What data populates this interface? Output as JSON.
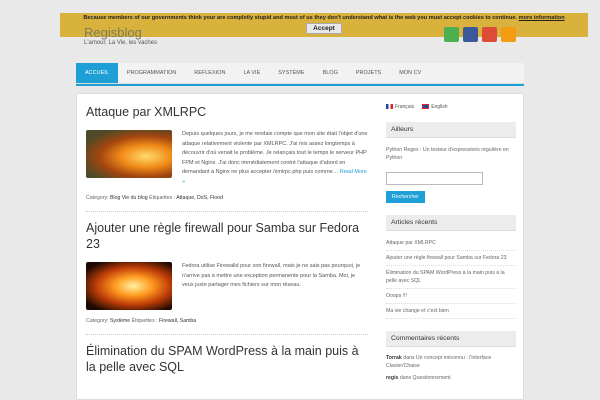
{
  "site": {
    "title": "Regisblog",
    "description": "L'amour, La Vie, les vaches"
  },
  "cookie": {
    "message": "Because members of our governments think your are completly stupid and most of us they don't understand what is the web you must accept cookies to continue.",
    "more_label": "more information",
    "accept_label": "Accept"
  },
  "social": [
    {
      "name": "twitter-icon",
      "color": "#4caf50"
    },
    {
      "name": "facebook-icon",
      "color": "#3b5998"
    },
    {
      "name": "google-plus-icon",
      "color": "#dd4b39"
    },
    {
      "name": "rss-icon",
      "color": "#f39c12"
    }
  ],
  "nav": {
    "items": [
      "ACCUEIL",
      "PROGRAMMATION",
      "REFLEXION",
      "LA VIE",
      "SYSTÈME",
      "BLOG",
      "PROJETS",
      "MON CV"
    ]
  },
  "posts": [
    {
      "title": "Attaque par XMLRPC",
      "excerpt": "Depuis quelques jours, je me rendais compte que mon site était l'objet d'une attaque relativement violente par XMLRPC. J'ai mis assez longtemps à découvrir d'où venait le problème. Je relançais tout le temps le serveur PHP FPM et Nginx. J'ai donc immédiatement contré l'attaque d'abord en demandant à Nginx ne plus accepter /xmlrpc.php puis comme…",
      "more": "Read More »",
      "category_label": "Category:",
      "categories": "Blog  Vie du blog",
      "tags_label": "Étiquettes :",
      "tags": "Attaque,  DoS,  Flood"
    },
    {
      "title": "Ajouter une règle firewall pour Samba sur Fedora 23",
      "excerpt": "Fedora utilise Firewalld pour son firewall, mais je ne sais pas pourquoi, je n'arrive pas à mettre une exception permanente pour la Samba. Moi, je veux juste partager mes fichiers sur mon réseau.",
      "category_label": "Category:",
      "categories": "Système",
      "tags_label": "Étiquettes :",
      "tags": "Firewall,  Samba"
    },
    {
      "title": "Élimination du SPAM WordPress à la main puis à la pelle avec SQL"
    }
  ],
  "sidebar": {
    "lang_fr": "Français",
    "lang_en": "English",
    "ailleurs_title": "Ailleurs",
    "ailleurs_text": "Python Regex : Un testeur d'expressions régulière en Python",
    "search_button": "Rechercher",
    "recent_title": "Articles récents",
    "recent": [
      "Attaque par XMLRPC",
      "Ajouter une règle firewall pour Samba sur Fedora 23",
      "Élimination du SPAM WordPress à la main puis à la pelle avec SQL",
      "Ooops !!!",
      "Ma vie change et c'est bien"
    ],
    "comments_title": "Commentaires récents",
    "comments": [
      {
        "author": "Torrak",
        "text": "dans Un concept méconnu : l'interface Clavier/Chaise"
      },
      {
        "author": "regis",
        "text": "dans Questionnement"
      }
    ]
  }
}
